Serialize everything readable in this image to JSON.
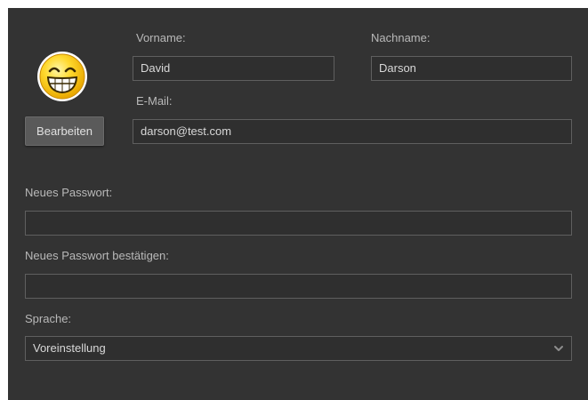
{
  "profile": {
    "first_name_label": "Vorname:",
    "first_name_value": "David",
    "last_name_label": "Nachname:",
    "last_name_value": "Darson",
    "email_label": "E-Mail:",
    "email_value": "darson@test.com",
    "edit_button_label": "Bearbeiten",
    "avatar_icon": "smiley-grin-icon"
  },
  "password": {
    "new_label": "Neues Passwort:",
    "new_value": "",
    "confirm_label": "Neues Passwort bestätigen:",
    "confirm_value": ""
  },
  "language": {
    "label": "Sprache:",
    "selected": "Voreinstellung",
    "chevron_icon": "chevron-down-icon"
  },
  "colors": {
    "panel_bg": "#333333",
    "field_border": "#5f5f5f",
    "label_text": "#b9b9b9",
    "avatar_yellow": "#f5c400"
  }
}
